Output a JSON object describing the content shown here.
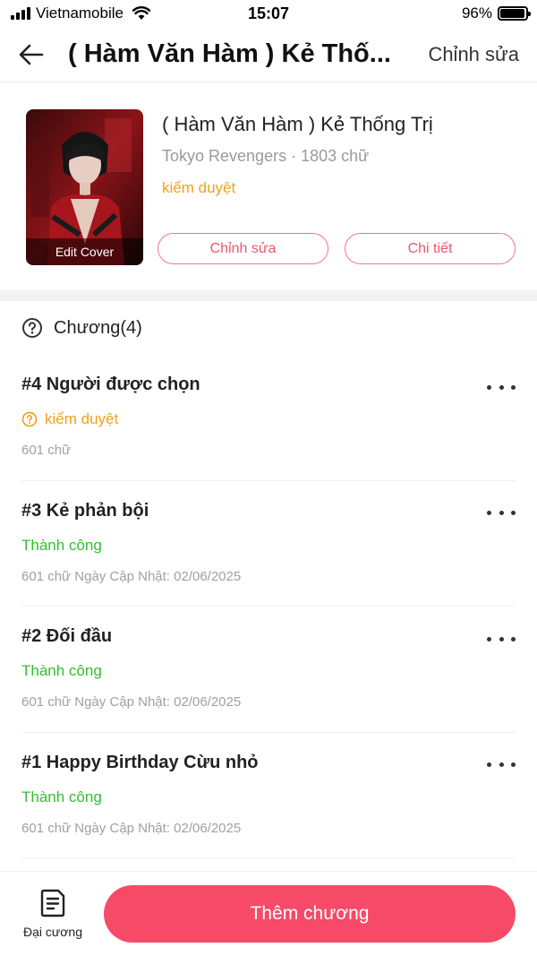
{
  "status_bar": {
    "carrier": "Vietnamobile",
    "time": "15:07",
    "battery": "96%",
    "battery_level": 0.96
  },
  "nav": {
    "title": "( Hàm Văn Hàm ) Kẻ Thố...",
    "edit_label": "Chỉnh sửa",
    "back_icon": "arrow-left-icon"
  },
  "book": {
    "title": "( Hàm Văn Hàm ) Kẻ Thống Trị",
    "meta": "Tokyo Revengers · 1803 chữ",
    "status": "kiểm duyệt",
    "cover_label": "Edit Cover",
    "edit_button": "Chỉnh sửa",
    "detail_button": "Chi tiết"
  },
  "chapters_header": {
    "label": "Chương(4)",
    "icon": "question-circle-icon"
  },
  "chapters": [
    {
      "title": "#4 Người được chọn",
      "status": "kiểm duyệt",
      "info": "601 chữ"
    },
    {
      "title": "#3 Kẻ phản bội",
      "status": "Thành công",
      "info": "601 chữ Ngày Cập Nhật: 02/06/2025"
    },
    {
      "title": "#2 Đối đầu",
      "status": "Thành công",
      "info": "601 chữ Ngày Cập Nhật: 02/06/2025"
    },
    {
      "title": "#1 Happy Birthday Cừu nhỏ",
      "status": "Thành công",
      "info": "601 chữ Ngày Cập Nhật: 02/06/2025"
    }
  ],
  "bottom": {
    "outline_label": "Đại cương",
    "add_chapter": "Thêm chương"
  },
  "colors": {
    "accent": "#f64a68",
    "review": "#f0a11a",
    "success": "#33bf2e"
  }
}
